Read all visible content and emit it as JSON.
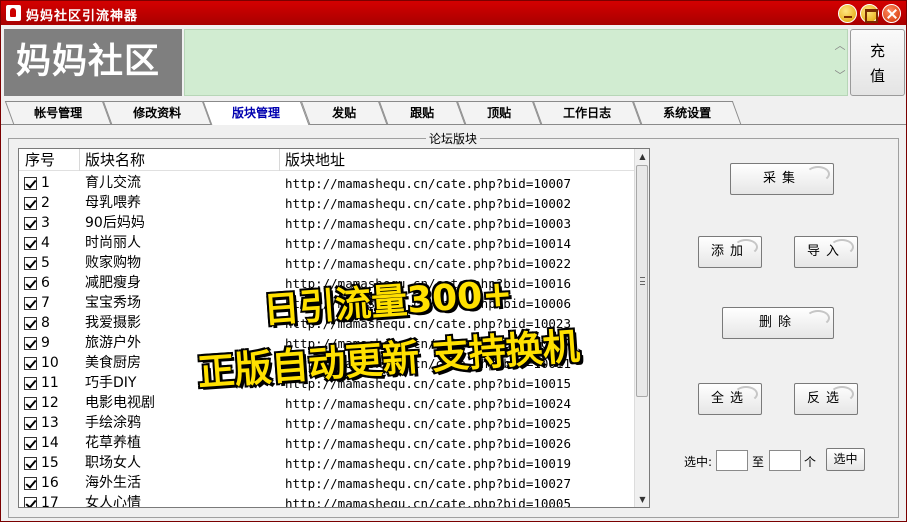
{
  "window": {
    "title": "妈妈社区引流神器"
  },
  "header": {
    "brand": "妈妈社区",
    "recharge_label_1": "充",
    "recharge_label_2": "值"
  },
  "tabs": [
    {
      "label": "帐号管理",
      "active": false
    },
    {
      "label": "修改资料",
      "active": false
    },
    {
      "label": "版块管理",
      "active": true
    },
    {
      "label": "发贴",
      "active": false
    },
    {
      "label": "跟贴",
      "active": false
    },
    {
      "label": "顶贴",
      "active": false
    },
    {
      "label": "工作日志",
      "active": false
    },
    {
      "label": "系统设置",
      "active": false
    }
  ],
  "group": {
    "title": "论坛版块"
  },
  "list": {
    "columns": [
      "序号",
      "版块名称",
      "版块地址"
    ],
    "rows": [
      {
        "checked": true,
        "index": "1",
        "name": "育儿交流",
        "url": "http://mamashequ.cn/cate.php?bid=10007"
      },
      {
        "checked": true,
        "index": "2",
        "name": "母乳喂养",
        "url": "http://mamashequ.cn/cate.php?bid=10002"
      },
      {
        "checked": true,
        "index": "3",
        "name": "90后妈妈",
        "url": "http://mamashequ.cn/cate.php?bid=10003"
      },
      {
        "checked": true,
        "index": "4",
        "name": "时尚丽人",
        "url": "http://mamashequ.cn/cate.php?bid=10014"
      },
      {
        "checked": true,
        "index": "5",
        "name": "败家购物",
        "url": "http://mamashequ.cn/cate.php?bid=10022"
      },
      {
        "checked": true,
        "index": "6",
        "name": "减肥瘦身",
        "url": "http://mamashequ.cn/cate.php?bid=10016"
      },
      {
        "checked": true,
        "index": "7",
        "name": "宝宝秀场",
        "url": "http://mamashequ.cn/cate.php?bid=10006"
      },
      {
        "checked": true,
        "index": "8",
        "name": "我爱摄影",
        "url": "http://mamashequ.cn/cate.php?bid=10023"
      },
      {
        "checked": true,
        "index": "9",
        "name": "旅游户外",
        "url": "http://mamashequ.cn/cate.php?bid=10017"
      },
      {
        "checked": true,
        "index": "10",
        "name": "美食厨房",
        "url": "http://mamashequ.cn/cate.php?bid=10011"
      },
      {
        "checked": true,
        "index": "11",
        "name": "巧手DIY",
        "url": "http://mamashequ.cn/cate.php?bid=10015"
      },
      {
        "checked": true,
        "index": "12",
        "name": "电影电视剧",
        "url": "http://mamashequ.cn/cate.php?bid=10024"
      },
      {
        "checked": true,
        "index": "13",
        "name": "手绘涂鸦",
        "url": "http://mamashequ.cn/cate.php?bid=10025"
      },
      {
        "checked": true,
        "index": "14",
        "name": "花草养植",
        "url": "http://mamashequ.cn/cate.php?bid=10026"
      },
      {
        "checked": true,
        "index": "15",
        "name": "职场女人",
        "url": "http://mamashequ.cn/cate.php?bid=10019"
      },
      {
        "checked": true,
        "index": "16",
        "name": "海外生活",
        "url": "http://mamashequ.cn/cate.php?bid=10027"
      },
      {
        "checked": true,
        "index": "17",
        "name": "女人心情",
        "url": "http://mamashequ.cn/cate.php?bid=10005"
      }
    ]
  },
  "actions": {
    "collect": "采集",
    "add": "添加",
    "import": "导入",
    "delete": "删除",
    "select_all": "全选",
    "invert": "反选"
  },
  "range_select": {
    "label_from": "选中:",
    "label_to": "至",
    "label_unit": "个",
    "from_value": "",
    "to_value": "",
    "button": "选中"
  },
  "promo": {
    "line1": "日引流量300+",
    "line2": "正版自动更新 支持换机"
  },
  "colors": {
    "titlebar": "#c80000",
    "banner": "#d1ecd1",
    "brand_bg": "#7f7f7f",
    "active_tab_text": "#0000b0",
    "promo_text": "#ffe000"
  }
}
